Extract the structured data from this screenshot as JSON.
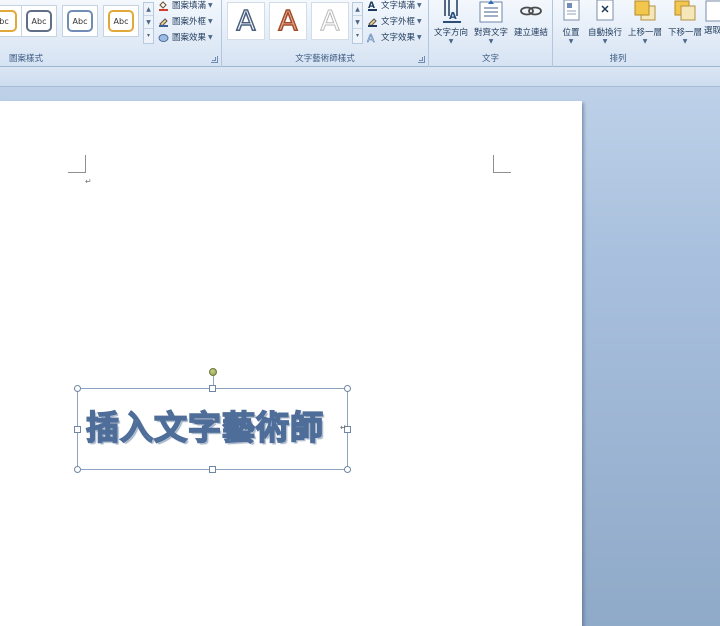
{
  "ribbon": {
    "shape_styles": {
      "label": "圖案樣式",
      "thumb_labels": [
        "bc",
        "Abc",
        "Abc",
        "Abc"
      ],
      "thumb_colors": [
        "#e0a93a",
        "#5f6f86",
        "#6f8db7",
        "#e0a93a"
      ],
      "fill": "圖案填滿",
      "outline": "圖案外框",
      "effects": "圖案效果"
    },
    "wordart_styles": {
      "label": "文字藝術師樣式",
      "glyphs": [
        "A",
        "A",
        "A"
      ],
      "text_fill": "文字填滿",
      "text_outline": "文字外框",
      "text_effects": "文字效果"
    },
    "text_group": {
      "label": "文字",
      "direction": "文字方向",
      "align": "對齊文字",
      "link": "建立連結"
    },
    "arrange_group": {
      "label": "排列",
      "position": "位置",
      "wrap": "自動換行",
      "bring_forward": "上移一層",
      "send_backward": "下移一層",
      "select_pane": "選取"
    }
  },
  "document": {
    "paragraph_mark": "↵",
    "wordart_text": "插入文字藝術師",
    "anchor_mark": "↵"
  },
  "colors": {
    "wordart_fill": "#8aaad3",
    "wordart_outline": "#4e6d98",
    "ribbon_bg": "#e3ecf7",
    "workspace_bg": "#a9c1de"
  }
}
